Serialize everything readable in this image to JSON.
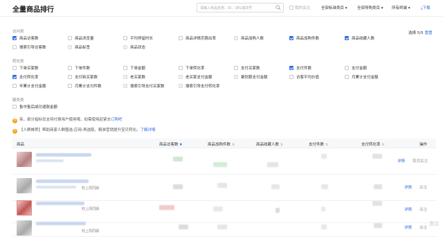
{
  "header": {
    "title": "全量商品排行",
    "search_placeholder": "请输入商品名称、ID、URL或货号",
    "only_followed": "我的关注",
    "all_std_category": "全部标准类目",
    "all_merchant_category": "全部导购类目",
    "all_terminals": "所有终端",
    "download": "下载"
  },
  "groups": [
    {
      "label": "访问类",
      "options": [
        {
          "label": "商品访客数",
          "checked": true
        },
        {
          "label": "商品浏览量",
          "checked": false
        },
        {
          "label": "平均停留时长",
          "checked": false
        },
        {
          "label": "商品详情页跳出率",
          "checked": false
        },
        {
          "label": "商品加购人数",
          "checked": false
        },
        {
          "label": "商品加购件数",
          "checked": true
        },
        {
          "label": "商品收藏人数",
          "checked": true
        },
        {
          "label": "搜索引导访客数",
          "checked": false
        },
        {
          "label": "商品标签",
          "checked": false
        },
        {
          "label": "商品状态",
          "checked": false
        }
      ]
    },
    {
      "label": "转化类",
      "options": [
        {
          "label": "下单买家数",
          "checked": false
        },
        {
          "label": "下单件数",
          "checked": false
        },
        {
          "label": "下单金额",
          "checked": false
        },
        {
          "label": "下单转化率",
          "checked": false
        },
        {
          "label": "支付买家数",
          "checked": false
        },
        {
          "label": "支付件数",
          "checked": true
        },
        {
          "label": "支付金额",
          "checked": false
        },
        {
          "label": "支付转化率",
          "checked": true
        },
        {
          "label": "支付新买家数",
          "checked": false
        },
        {
          "label": "老买家数",
          "checked": false
        },
        {
          "label": "老买家支付金额",
          "checked": false
        },
        {
          "label": "聚划算支付金额",
          "checked": false
        },
        {
          "label": "访客平均价值",
          "checked": false
        },
        {
          "label": "月累计支付金额",
          "checked": false
        },
        {
          "label": "年累计支付金额",
          "checked": false
        },
        {
          "label": "月累计支付件数",
          "checked": false
        },
        {
          "label": "搜索引导支付买家数",
          "checked": false
        },
        {
          "label": "搜索引导支付转化率",
          "checked": false
        }
      ]
    },
    {
      "label": "服务类",
      "options": [
        {
          "label": "售中售后成功退款金额",
          "checked": false
        }
      ]
    }
  ],
  "selection": {
    "count_text": "选择 5/5",
    "reset": "重置"
  },
  "notices": {
    "n1_text": "亲，部分指标仅支持付费用户使用哦，如需使用赶紧去",
    "n1_link": "订购吧",
    "n2_text": "【人群推荐】帮助商家人群圈选-应用-再选取，精准营销提升宝贝转化。",
    "n2_link": "了解详情"
  },
  "table": {
    "columns": [
      "商品",
      "商品访客数",
      "商品加购件数",
      "商品收藏人数",
      "支付件数",
      "支付转化率",
      "操作"
    ],
    "rows": [
      {
        "meta": "",
        "detail": "详情",
        "follow": "取消关注"
      },
      {
        "meta": "较上周同期",
        "detail": "详情",
        "follow": "关注"
      },
      {
        "meta": "较上周同期",
        "detail": "详情",
        "follow": "关注"
      },
      {
        "meta": "较上周同期",
        "detail": "详情",
        "follow": "关注"
      }
    ]
  },
  "watermark": "激活"
}
